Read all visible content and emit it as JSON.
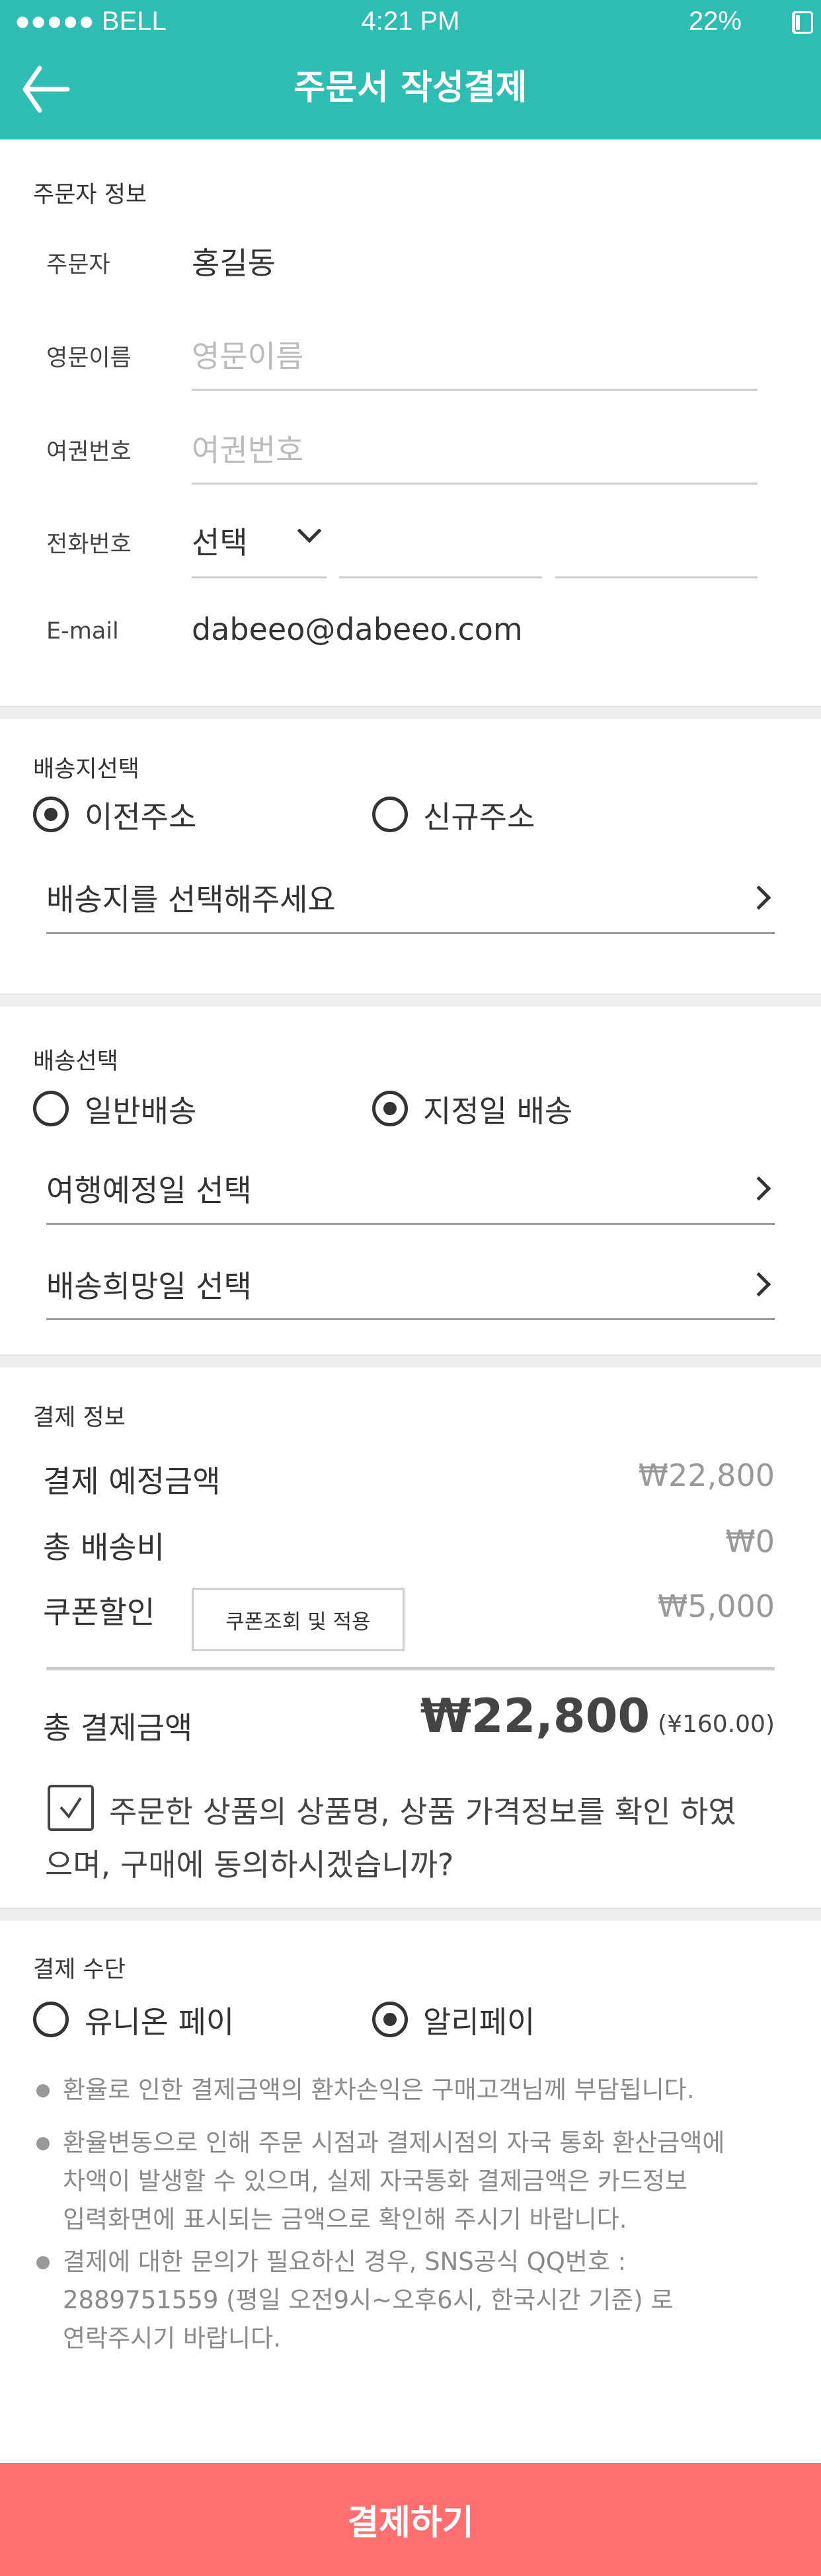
{
  "status_bar": {
    "carrier": "●●●●● BELL",
    "time": "4:21 PM",
    "battery": "22%"
  },
  "header": {
    "title": "주문서 작성결제"
  },
  "orderer": {
    "heading": "주문자 정보",
    "name_label": "주문자",
    "name_value": "홍길동",
    "eng_label": "영문이름",
    "eng_placeholder": "영문이름",
    "passport_label": "여권번호",
    "passport_placeholder": "여권번호",
    "phone_label": "전화번호",
    "phone_select": "선택",
    "email_label": "E-mail",
    "email_value": "dabeeo@dabeeo.com"
  },
  "address": {
    "heading": "배송지선택",
    "option_prev": "이전주소",
    "option_new": "신규주소",
    "selected": "이전주소",
    "select_label": "배송지를 선택해주세요"
  },
  "delivery": {
    "heading": "배송선택",
    "option_normal": "일반배송",
    "option_date": "지정일 배송",
    "selected": "지정일 배송",
    "travel_date": "여행예정일 선택",
    "wish_date": "배송희망일 선택"
  },
  "payment_info": {
    "heading": "결제 정보",
    "planned_label": "결제 예정금액",
    "planned_value": "₩22,800",
    "shipping_label": "총 배송비",
    "shipping_value": "₩0",
    "coupon_label": "쿠폰할인",
    "coupon_button": "쿠폰조회 및 적용",
    "coupon_value": "₩5,000",
    "total_label": "총 결제금액",
    "total_value": "₩22,800",
    "total_cny": "(¥160.00)",
    "agree_checked": true,
    "agree_line1": "주문한 상품의 상품명, 상품 가격정보를 확인 하였",
    "agree_line2": "으며, 구매에 동의하시겠습니까?"
  },
  "method": {
    "heading": "결제 수단",
    "option_union": "유니온 페이",
    "option_ali": "알리페이",
    "selected": "알리페이",
    "notes": [
      [
        "환율로 인한 결제금액의 환차손익은 구매고객님께 부담됩니다."
      ],
      [
        "환율변동으로 인해 주문 시점과 결제시점의 자국 통화 환산금액에",
        "차액이 발생할 수 있으며, 실제 자국통화 결제금액은 카드정보",
        "입력화면에 표시되는 금액으로 확인해 주시기 바랍니다."
      ],
      [
        "결제에 대한 문의가 필요하신 경우, SNS공식 QQ번호 :",
        "2889751559 (평일 오전9시~오후6시, 한국시간 기준) 로",
        "연락주시기 바랍니다."
      ]
    ]
  },
  "footer": {
    "pay_button": "결제하기"
  },
  "colors": {
    "primary": "#2ebdb3",
    "pay_button": "#ff6f6f"
  }
}
